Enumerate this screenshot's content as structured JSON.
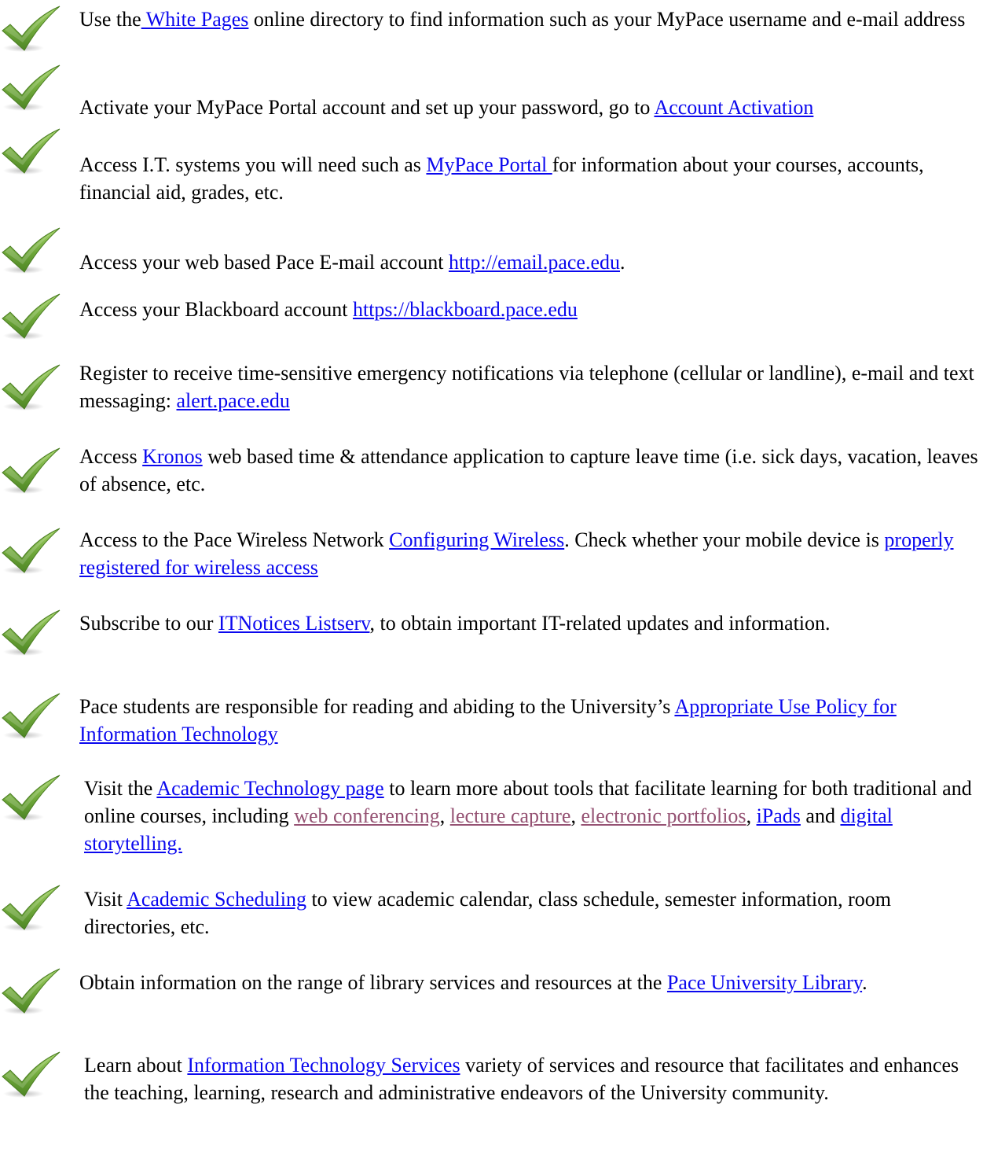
{
  "colors": {
    "link": "#0b08ee",
    "visited_link": "#955273",
    "check_green": "#6fa83a"
  },
  "icons": {
    "check": "check-mark-icon"
  },
  "items": [
    {
      "pre": "Use the",
      "link": " White Pages",
      "post": " online directory to find information such as your MyPace username and e-mail address"
    },
    {
      "pre": "Activate your MyPace Portal account and set up your password, go to ",
      "link": "Account Activation"
    },
    {
      "pre": "Access I.T. systems you will need such as ",
      "link": "MyPace Portal ",
      "post": "for information about your courses, accounts, financial aid, grades, etc."
    },
    {
      "pre": "Access your web based Pace E-mail account ",
      "link": "http://email.pace.edu",
      "post": "."
    },
    {
      "pre": "Access your Blackboard account ",
      "link": "https://blackboard.pace.edu"
    },
    {
      "pre": "Register to receive time-sensitive emergency notifications via telephone (cellular or landline), e-mail and text messaging: ",
      "link": "alert.pace.edu"
    },
    {
      "pre": "Access ",
      "link": "Kronos",
      "post": " web based time & attendance application to capture leave time (i.e. sick days, vacation, leaves of absence, etc."
    },
    {
      "pre": "Access to the Pace Wireless Network ",
      "link": "Configuring Wireless",
      "mid": ". Check whether your mobile device is ",
      "link2": "properly registered for wireless access"
    },
    {
      "pre": "Subscribe to our ",
      "link": "ITNotices Listserv",
      "post": ", to obtain important IT-related updates and information."
    },
    {
      "pre": "Pace students are responsible for reading and abiding to the University’s ",
      "link": "Appropriate Use Policy for Information Technology"
    },
    {
      "pre": "Visit the ",
      "link": "Academic Technology page",
      "mid": " to learn more about tools that facilitate learning for both traditional and online courses, including ",
      "link2": "web conferencing",
      "sep1": ", ",
      "link3": "lecture capture",
      "sep2": ", ",
      "link4": "electronic portfolios",
      "sep3": ", ",
      "link5": "iPads",
      "sep4": " and ",
      "link6": "digital storytelling."
    },
    {
      "pre": "Visit ",
      "link": "Academic Scheduling",
      "post": " to view academic calendar, class schedule, semester information, room directories, etc."
    },
    {
      "pre": "Obtain information on the range of library services and resources at the ",
      "link": "Pace University Library",
      "post": "."
    },
    {
      "pre": "Learn about ",
      "link": "Information Technology Services",
      "post": " variety of services and resource that facilitates and enhances the teaching, learning, research and administrative endeavors of the University community."
    }
  ]
}
